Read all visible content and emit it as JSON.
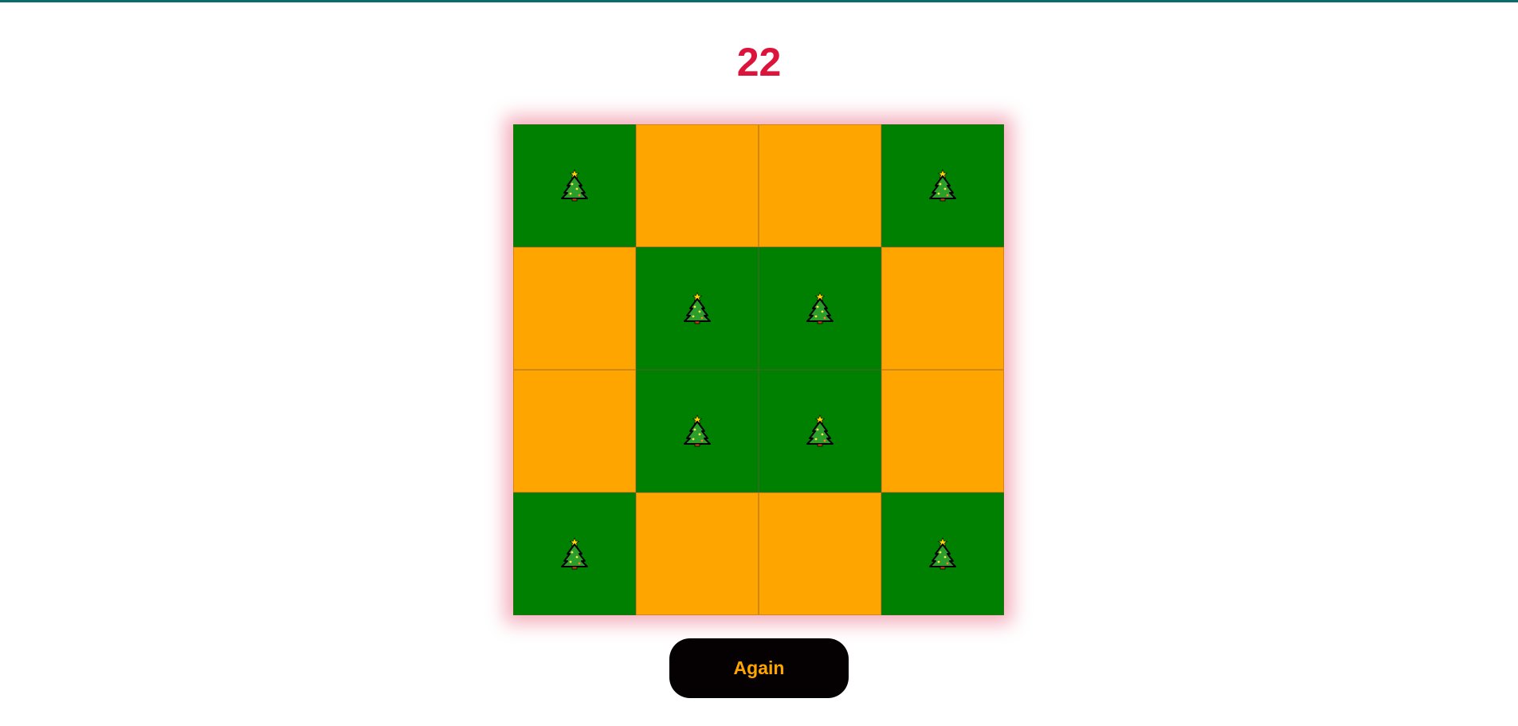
{
  "score": "22",
  "board": {
    "rows": 4,
    "cols": 4,
    "cells": [
      [
        "tree",
        "empty",
        "empty",
        "tree"
      ],
      [
        "empty",
        "tree",
        "tree",
        "empty"
      ],
      [
        "empty",
        "tree",
        "tree",
        "empty"
      ],
      [
        "tree",
        "empty",
        "empty",
        "tree"
      ]
    ],
    "tree_icon": "christmas-tree-icon",
    "colors": {
      "tree_cell": "#008000",
      "empty_cell": "#ffa500",
      "glow": "#dc143c"
    }
  },
  "again_button": {
    "label": "Again"
  },
  "colors": {
    "score": "#dc143c",
    "top_bar": "#0e6b6b",
    "button_bg": "#050102",
    "button_text": "#ffa500"
  }
}
